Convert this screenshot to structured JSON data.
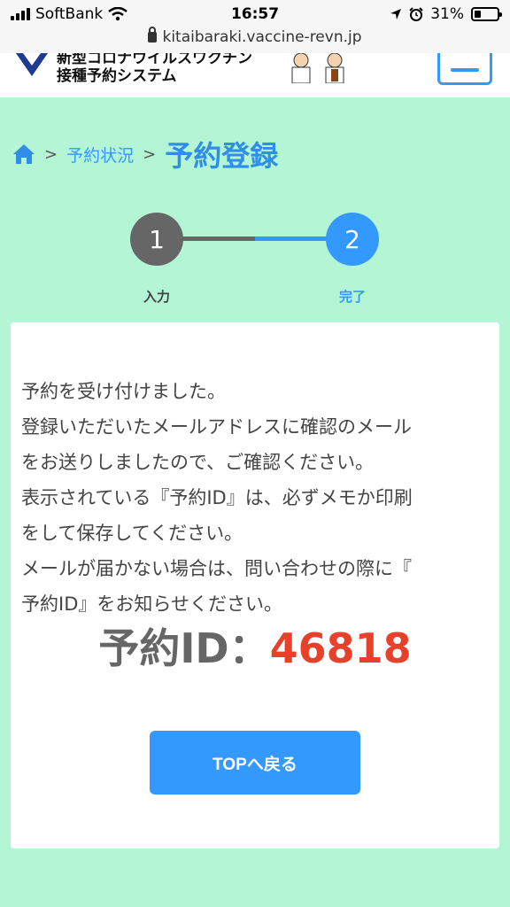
{
  "status_bar": {
    "carrier": "SoftBank",
    "time": "16:57",
    "battery": "31%",
    "battery_level": 0.31
  },
  "browser": {
    "url": "kitaibaraki.vaccine-revn.jp"
  },
  "header": {
    "title_line1": "新型コロナウイルスワクチン",
    "title_line2": "接種予約システム"
  },
  "breadcrumb": {
    "link": "予約状況",
    "separator": ">",
    "current": "予約登録"
  },
  "stepper": {
    "steps": [
      {
        "number": "1",
        "label": "入力"
      },
      {
        "number": "2",
        "label": "完了"
      }
    ]
  },
  "message": {
    "lines": [
      "予約を受け付けました。",
      "登録いただいたメールアドレスに確認のメール",
      "をお送りしましたので、ご確認ください。",
      "表示されている『予約ID』は、必ずメモか印刷",
      "をして保存してください。",
      "メールが届かない場合は、問い合わせの際に『",
      "予約ID』をお知らせください。"
    ]
  },
  "reservation": {
    "label": "予約ID：",
    "value": "46818"
  },
  "actions": {
    "top_button": "TOPへ戻る"
  },
  "colors": {
    "background": "#b4f5d6",
    "accent": "#3399ff",
    "id_value": "#e8402a",
    "step_inactive": "#666666"
  }
}
